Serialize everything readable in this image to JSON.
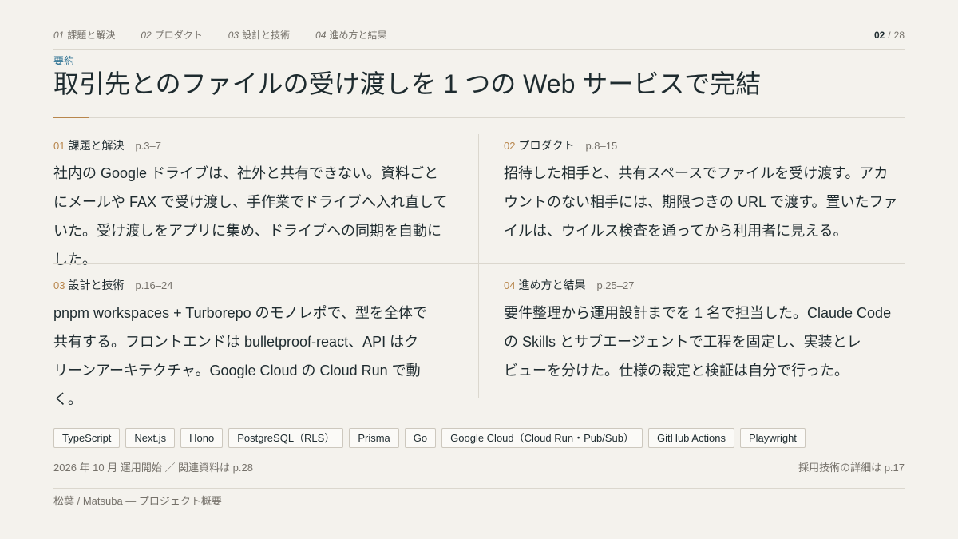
{
  "nav": {
    "items": [
      {
        "num": "01",
        "label": "課題と解決"
      },
      {
        "num": "02",
        "label": "プロダクト"
      },
      {
        "num": "03",
        "label": "設計と技術"
      },
      {
        "num": "04",
        "label": "進め方と結果"
      }
    ]
  },
  "page_counter": {
    "current": "02",
    "separator": "/",
    "total": "28"
  },
  "eyebrow": "要約",
  "title": "取引先とのファイルの受け渡しを 1 つの Web サービスで完結",
  "sections": [
    {
      "num": "01",
      "heading": "課題と解決",
      "pages": "p.3–7",
      "lines": [
        "社内の Google ドライブは、社外と共有できない。資料ごと",
        "にメールや FAX で受け渡し、手作業でドライブへ入れ直して",
        "いた。受け渡しをアプリに集め、ドライブへの同期を自動に",
        "した。"
      ]
    },
    {
      "num": "02",
      "heading": "プロダクト",
      "pages": "p.8–15",
      "lines": [
        "招待した相手と、共有スペースでファイルを受け渡す。アカ",
        "ウントのない相手には、期限つきの URL で渡す。置いたファ",
        "イルは、ウイルス検査を通ってから利用者に見える。"
      ]
    },
    {
      "num": "03",
      "heading": "設計と技術",
      "pages": "p.16–24",
      "lines": [
        "pnpm workspaces + Turborepo のモノレポで、型を全体で",
        "共有する。フロントエンドは bulletproof-react、API はク",
        "リーンアーキテクチャ。Google Cloud の Cloud Run で動",
        "く。"
      ]
    },
    {
      "num": "04",
      "heading": "進め方と結果",
      "pages": "p.25–27",
      "lines": [
        "要件整理から運用設計までを 1 名で担当した。Claude Code",
        "の Skills とサブエージェントで工程を固定し、実装とレ",
        "ビューを分けた。仕様の裁定と検証は自分で行った。"
      ]
    }
  ],
  "tags": [
    "TypeScript",
    "Next.js",
    "Hono",
    "PostgreSQL（RLS）",
    "Prisma",
    "Go",
    "Google Cloud（Cloud Run・Pub/Sub）",
    "GitHub Actions",
    "Playwright"
  ],
  "footer": {
    "left": "2026 年 10 月 運用開始 ／ 関連資料は p.28",
    "right": "採用技術の詳細は p.17"
  },
  "credit": "松葉 / Matsuba — プロジェクト概要",
  "colors": {
    "background": "#f4f2ed",
    "text": "#1e2b2f",
    "muted": "#75716a",
    "accent": "#b8864c",
    "eyebrow": "#2f7394",
    "rule": "#dbd7ce"
  }
}
